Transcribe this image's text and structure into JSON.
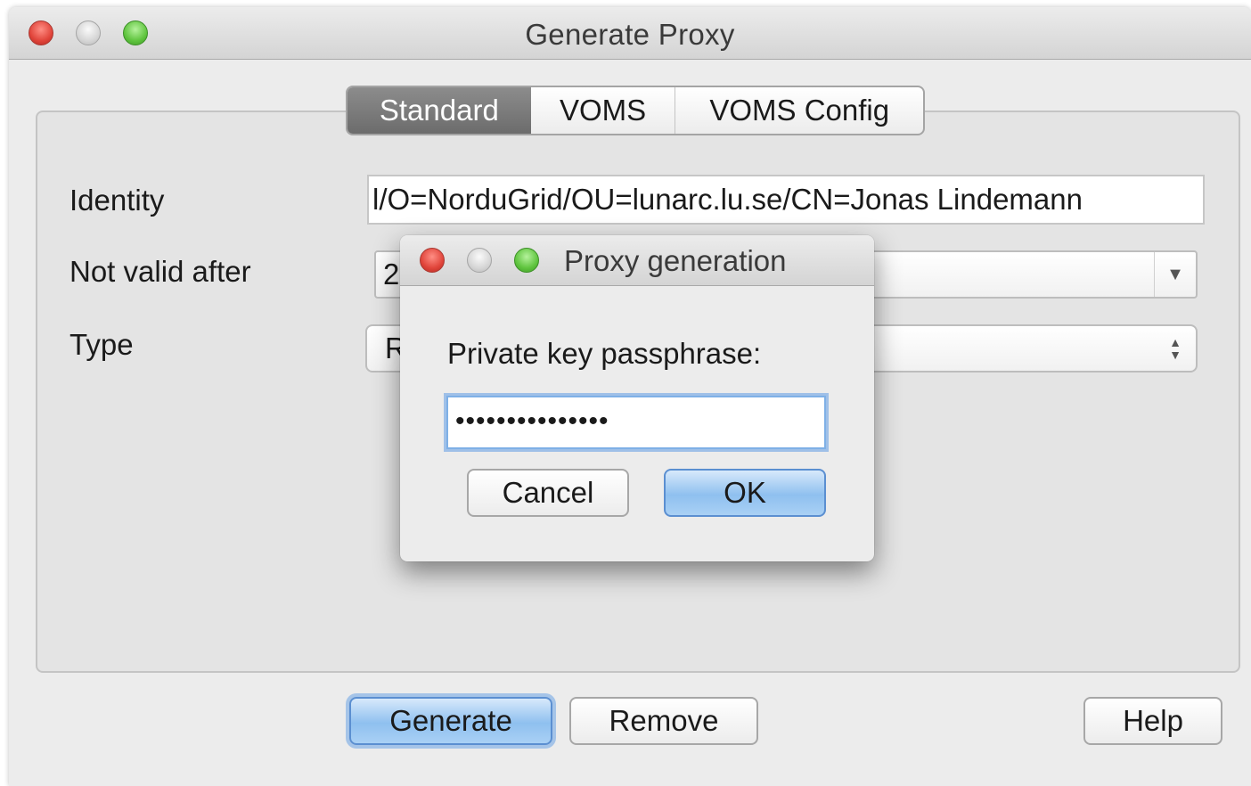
{
  "window": {
    "title": "Generate Proxy"
  },
  "tabs": [
    {
      "label": "Standard",
      "active": true
    },
    {
      "label": "VOMS",
      "active": false
    },
    {
      "label": "VOMS Config",
      "active": false
    }
  ],
  "form": {
    "identity_label": "Identity",
    "identity_value": "l/O=NorduGrid/OU=lunarc.lu.se/CN=Jonas Lindemann",
    "not_valid_after_label": "Not valid after",
    "not_valid_after_value_visible": "2",
    "type_label": "Type",
    "type_value_visible": "R"
  },
  "buttons": {
    "generate": "Generate",
    "remove": "Remove",
    "help": "Help"
  },
  "dialog": {
    "title": "Proxy generation",
    "prompt": "Private key passphrase:",
    "passphrase_masked": "•••••••••••••••",
    "cancel": "Cancel",
    "ok": "OK"
  },
  "colors": {
    "accent": "#8fc0ef",
    "close": "#e0443a",
    "maximize": "#5fc43e"
  }
}
